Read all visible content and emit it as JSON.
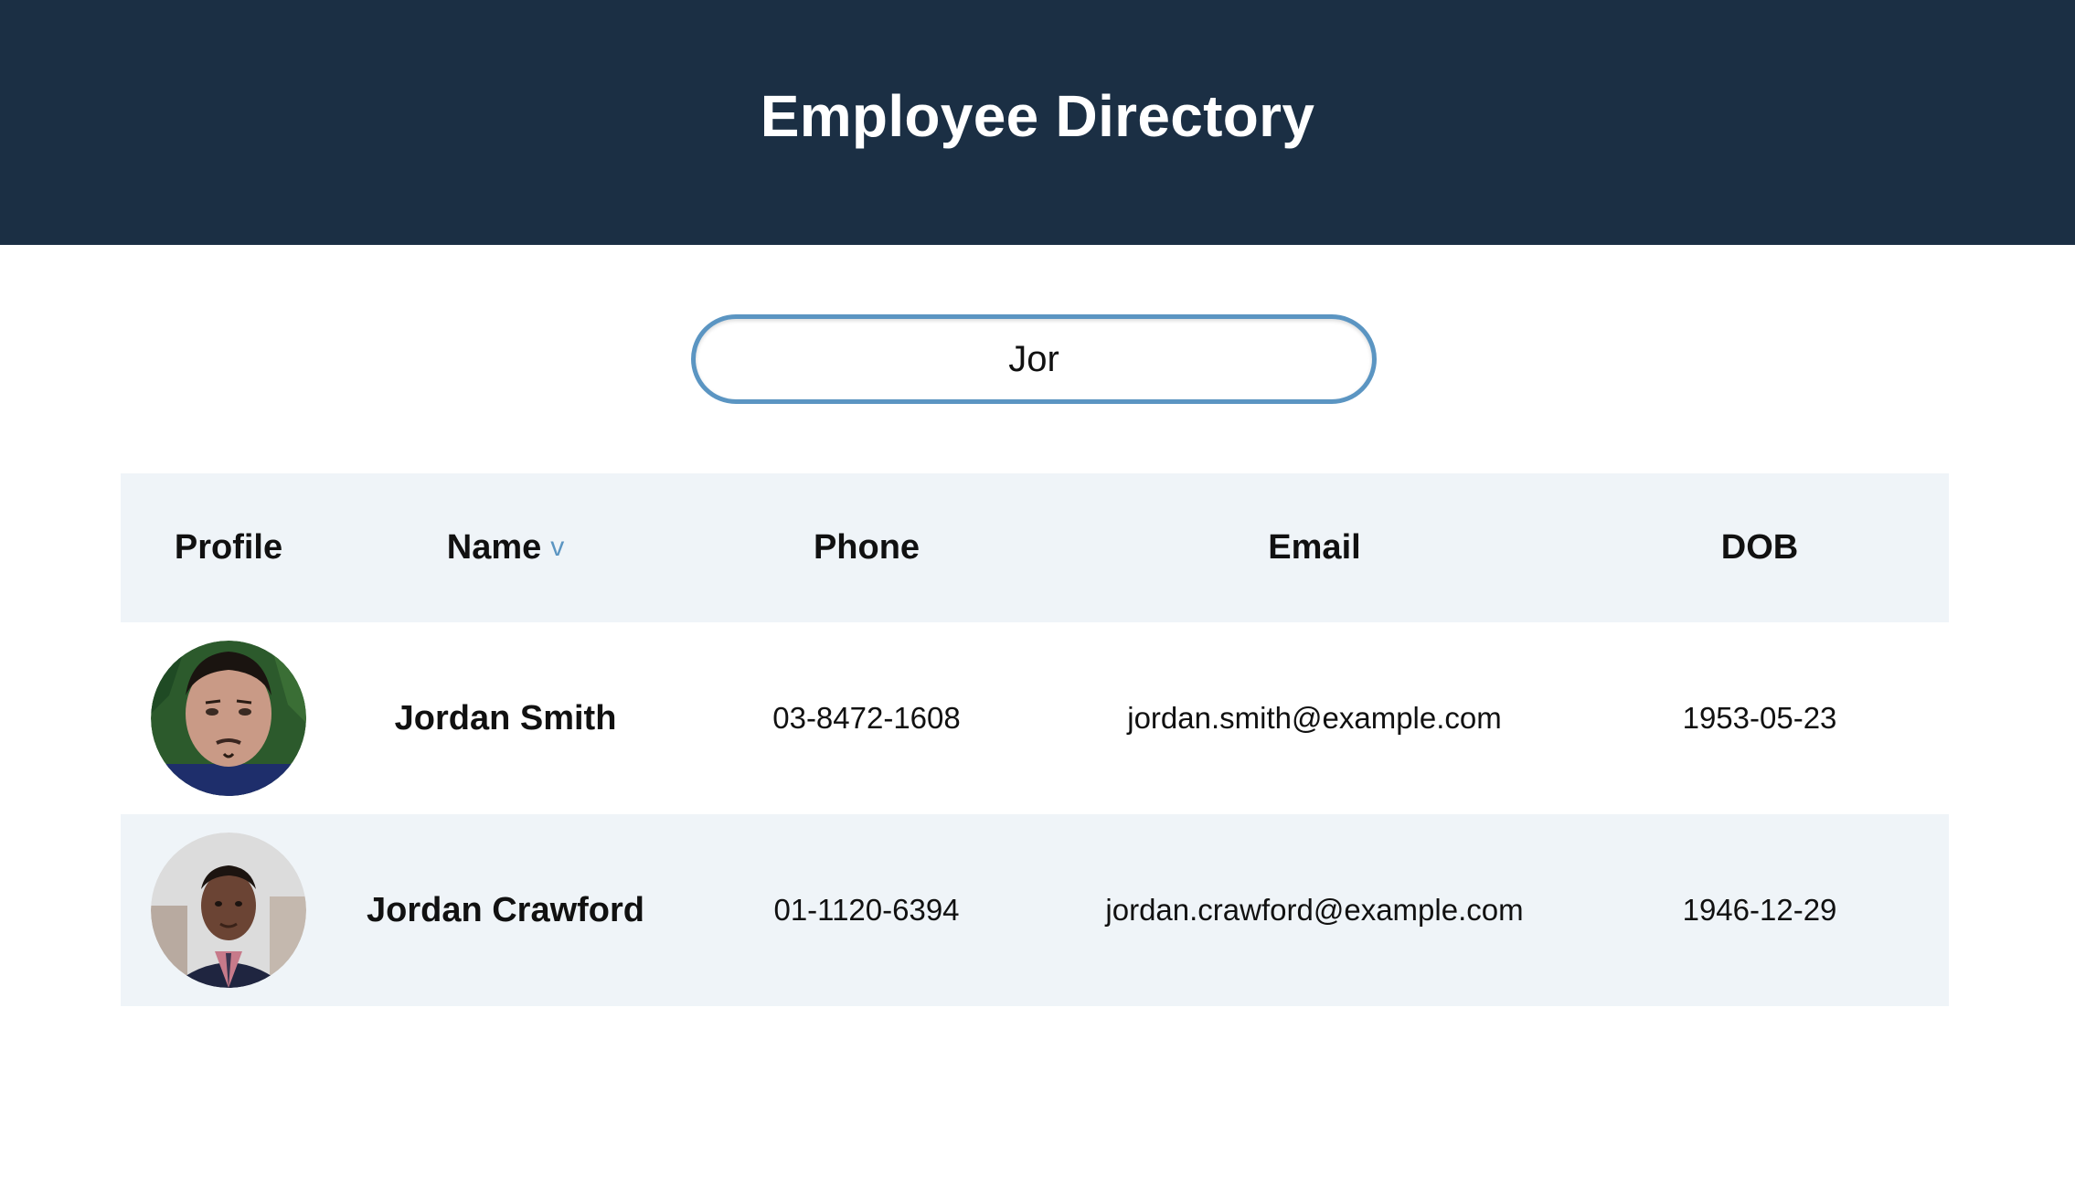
{
  "header": {
    "title": "Employee Directory"
  },
  "search": {
    "value": "Jor"
  },
  "table": {
    "columns": {
      "profile": "Profile",
      "name": "Name",
      "name_sort_indicator": "v",
      "phone": "Phone",
      "email": "Email",
      "dob": "DOB"
    },
    "rows": [
      {
        "name": "Jordan Smith",
        "phone": "03-8472-1608",
        "email": "jordan.smith@example.com",
        "dob": "1953-05-23",
        "avatar": "profile-photo"
      },
      {
        "name": "Jordan Crawford",
        "phone": "01-1120-6394",
        "email": "jordan.crawford@example.com",
        "dob": "1946-12-29",
        "avatar": "profile-photo"
      }
    ]
  },
  "colors": {
    "header_bg": "#1b2f44",
    "accent": "#5b95c2",
    "row_alt_bg": "#eff4f8"
  }
}
